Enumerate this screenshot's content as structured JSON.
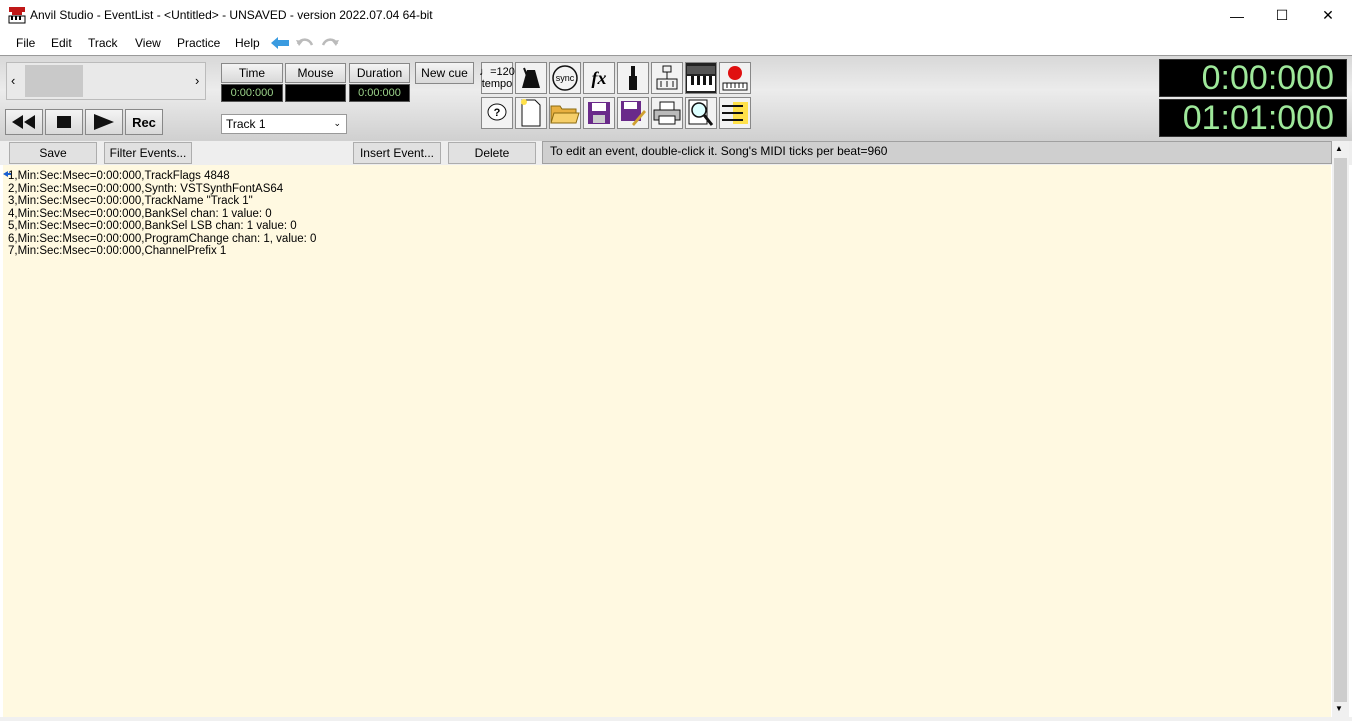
{
  "window": {
    "title": "Anvil Studio - EventList - <Untitled> - UNSAVED - version 2022.07.04 64-bit",
    "minimize": "—",
    "maximize": "☐",
    "close": "✕"
  },
  "menu": [
    "File",
    "Edit",
    "Track",
    "View",
    "Practice",
    "Help"
  ],
  "toolbar": {
    "time_label": "Time",
    "mouse_label": "Mouse",
    "duration_label": "Duration",
    "new_cue_label": "New cue",
    "time_value": "0:00:000",
    "mouse_value": "",
    "duration_value": "0:00:000",
    "rec_label": "Rec",
    "track_select": "Track 1",
    "tempo_value": "=120",
    "tempo_label": "tempo",
    "sync_label": "sync",
    "fx_label": "fx"
  },
  "clock": {
    "time": "0:00:000",
    "measure": "01:01:000"
  },
  "eventlist": {
    "save_label": "Save",
    "filter_label": "Filter Events...",
    "insert_label": "Insert Event...",
    "delete_label": "Delete",
    "hint": "To edit an event, double-click it. Song's MIDI ticks per beat=960",
    "rows": [
      "1,Min:Sec:Msec=0:00:000,TrackFlags 4848",
      "2,Min:Sec:Msec=0:00:000,Synth: VSTSynthFontAS64",
      "3,Min:Sec:Msec=0:00:000,TrackName \"Track 1\"",
      "4,Min:Sec:Msec=0:00:000,BankSel chan: 1 value: 0",
      "5,Min:Sec:Msec=0:00:000,BankSel LSB chan: 1 value: 0",
      "6,Min:Sec:Msec=0:00:000,ProgramChange chan: 1, value: 0",
      "7,Min:Sec:Msec=0:00:000,ChannelPrefix 1"
    ]
  },
  "colors": {
    "list_background": "#fff9e1",
    "clock_text": "#9ee89a",
    "accent_arrow": "#3a9be0"
  }
}
